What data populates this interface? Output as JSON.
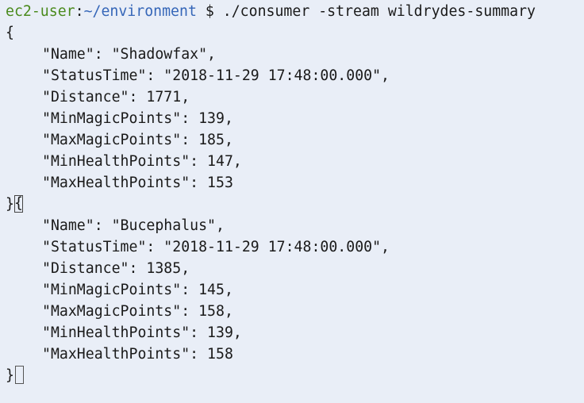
{
  "prompt": {
    "user_host": "ec2-user",
    "separator": ":",
    "path": "~/environment",
    "symbol": "$",
    "command": "./consumer -stream wildrydes-summary"
  },
  "records": [
    {
      "open": "{",
      "fields": [
        "\"Name\": \"Shadowfax\",",
        "\"StatusTime\": \"2018-11-29 17:48:00.000\",",
        "\"Distance\": 1771,",
        "\"MinMagicPoints\": 139,",
        "\"MaxMagicPoints\": 185,",
        "\"MinHealthPoints\": 147,",
        "\"MaxHealthPoints\": 153"
      ]
    },
    {
      "open": "{",
      "fields": [
        "\"Name\": \"Bucephalus\",",
        "\"StatusTime\": \"2018-11-29 17:48:00.000\",",
        "\"Distance\": 1385,",
        "\"MinMagicPoints\": 145,",
        "\"MaxMagicPoints\": 158,",
        "\"MinHealthPoints\": 139,",
        "\"MaxHealthPoints\": 158"
      ]
    }
  ],
  "close_brace": "}"
}
